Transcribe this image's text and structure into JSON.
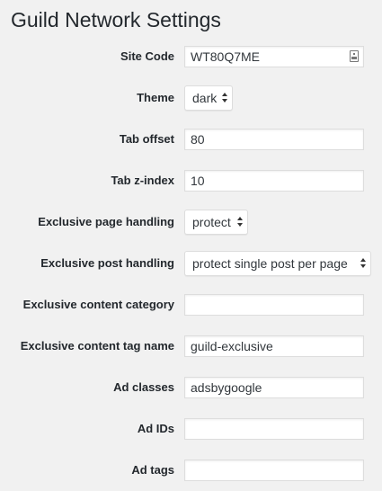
{
  "page": {
    "title": "Guild Network Settings"
  },
  "fields": {
    "site_code": {
      "label": "Site Code",
      "value": "WT80Q7ME",
      "icon": "contact-card-icon"
    },
    "theme": {
      "label": "Theme",
      "value": "dark"
    },
    "tab_offset": {
      "label": "Tab offset",
      "value": "80"
    },
    "tab_z_index": {
      "label": "Tab z-index",
      "value": "10"
    },
    "exclusive_page_handling": {
      "label": "Exclusive page handling",
      "value": "protect"
    },
    "exclusive_post_handling": {
      "label": "Exclusive post handling",
      "value": "protect single post per page"
    },
    "exclusive_content_category": {
      "label": "Exclusive content category",
      "value": ""
    },
    "exclusive_content_tag_name": {
      "label": "Exclusive content tag name",
      "value": "guild-exclusive"
    },
    "ad_classes": {
      "label": "Ad classes",
      "value": "adsbygoogle"
    },
    "ad_ids": {
      "label": "Ad IDs",
      "value": ""
    },
    "ad_tags": {
      "label": "Ad tags",
      "value": ""
    }
  },
  "colors": {
    "background": "#f1f1f1",
    "text": "#23282d",
    "field_border": "#dddddd",
    "field_background": "#ffffff"
  }
}
